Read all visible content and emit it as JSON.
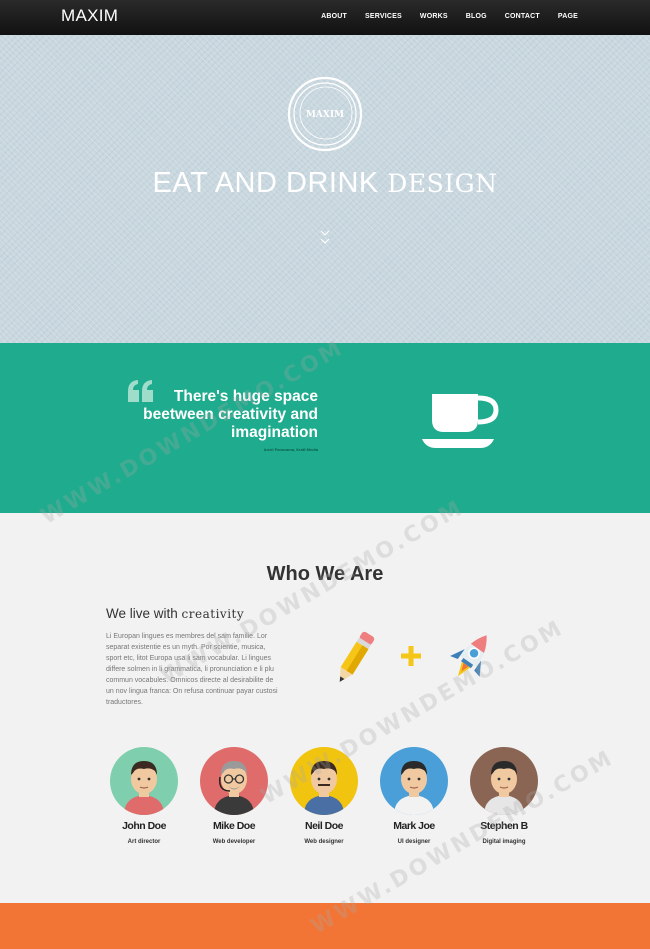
{
  "nav": {
    "logo": "MAXIM",
    "items": [
      "ABOUT",
      "SERVICES",
      "WORKS",
      "BLOG",
      "CONTACT",
      "PAGE"
    ]
  },
  "hero": {
    "badge_text": "MAXIM",
    "title_part1": "EAT AND DRINK",
    "title_part2": "DESIGN"
  },
  "quote": {
    "text": "There's huge space beetween creativity and imagination",
    "author": "Anvil Panorama, Kraft Media"
  },
  "who": {
    "title": "Who We Are",
    "subtitle_part1": "We live with",
    "subtitle_part2": "creativity",
    "paragraph": "Li Europan lingues es membres del sam familie. Lor separat existentie es un myth. Por scientie, musica, sport etc, litot Europa usa li sam vocabular. Li lingues differe solmen in li grammatica, li pronunciation e li plu commun vocabules. Omnicos directe al desirabilite de un nov lingua franca: On refusa continuar payar custosi traductores."
  },
  "team": [
    {
      "name": "John Doe",
      "role": "Art director",
      "color": "#7fcfae"
    },
    {
      "name": "Mike Doe",
      "role": "Web developer",
      "color": "#e06b6b"
    },
    {
      "name": "Neil Doe",
      "role": "Web designer",
      "color": "#f1c40f"
    },
    {
      "name": "Mark Joe",
      "role": "UI designer",
      "color": "#4a9fd8"
    },
    {
      "name": "Stephen B",
      "role": "Digital imaging",
      "color": "#8a6553"
    }
  ],
  "watermark": "WWW.DOWNDEMO.COM",
  "colors": {
    "teal": "#1fab8d",
    "orange": "#f27535",
    "hero_bg": "#c9d7df"
  }
}
